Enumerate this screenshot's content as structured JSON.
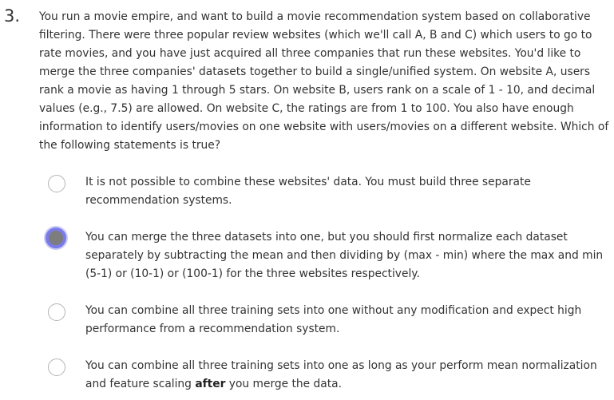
{
  "question": {
    "number": "3.",
    "text": "You run a movie empire, and want to build a movie recommendation system based on collaborative filtering. There were three popular review websites (which we'll call A, B and C) which users to go to rate movies, and you have just acquired all three companies that run these websites. You'd like to merge the three companies' datasets together to build a single/unified system. On website A, users rank a movie as having 1 through 5 stars. On website B, users rank on a scale of 1 - 10, and decimal values (e.g., 7.5) are allowed. On website C, the ratings are from 1 to 100. You also have enough information to identify users/movies on one website with users/movies on a different website. Which of the following statements is true?"
  },
  "options": [
    {
      "text": "It is not possible to combine these websites' data. You must build three separate recommendation systems.",
      "selected": false
    },
    {
      "text": "You can merge the three datasets into one, but you should first normalize each dataset separately by subtracting the mean and then dividing by (max - min) where the max and min (5-1) or (10-1) or (100-1) for the three websites respectively.",
      "selected": true
    },
    {
      "text": "You can combine all three training sets into one without any modification and expect high performance from a recommendation system.",
      "selected": false
    },
    {
      "text_before": "You can combine all three training sets into one as long as your perform mean normalization and feature scaling ",
      "text_bold": "after",
      "text_after": " you merge the data.",
      "selected": false
    }
  ]
}
